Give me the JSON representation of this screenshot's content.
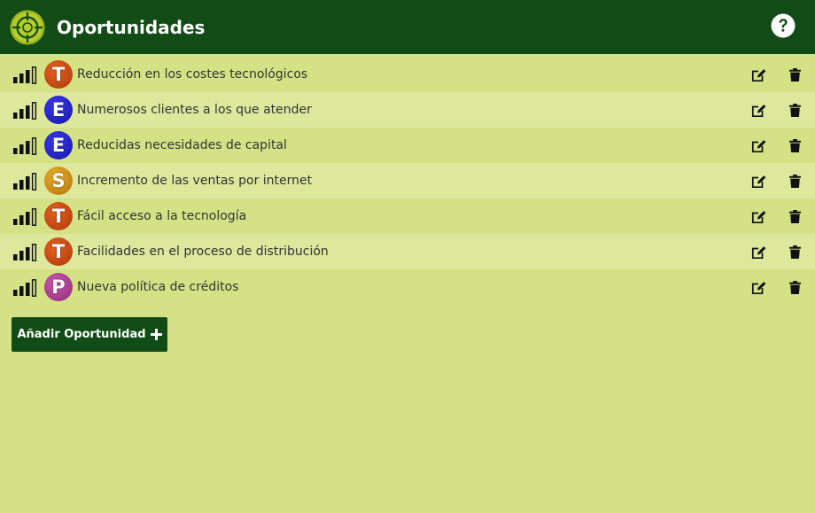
{
  "header": {
    "title": "Oportunidades",
    "logo_icon": "target-crosshair-icon",
    "help_icon": "question-circle-icon"
  },
  "items": [
    {
      "label": "Reducción en los costes tecnológicos",
      "letter": "T",
      "color": "#d9480f",
      "color_dark": "#a83a0c",
      "signal_level": 3
    },
    {
      "label": "Numerosos clientes a los que atender",
      "letter": "E",
      "color": "#2424d6",
      "color_dark": "#1616a0",
      "signal_level": 3
    },
    {
      "label": "Reducidas necesidades de capital",
      "letter": "E",
      "color": "#2424d6",
      "color_dark": "#1616a0",
      "signal_level": 3
    },
    {
      "label": "Incremento de las ventas por internet",
      "letter": "S",
      "color": "#dd9a10",
      "color_dark": "#b2700a",
      "signal_level": 3
    },
    {
      "label": "Fácil acceso a la tecnología",
      "letter": "T",
      "color": "#d9480f",
      "color_dark": "#a83a0c",
      "signal_level": 3
    },
    {
      "label": "Facilidades en el proceso de distribución",
      "letter": "T",
      "color": "#d9480f",
      "color_dark": "#a83a0c",
      "signal_level": 3
    },
    {
      "label": "Nueva política de créditos",
      "letter": "P",
      "color": "#b8409a",
      "color_dark": "#8c2c74",
      "signal_level": 3
    }
  ],
  "row_icons": {
    "signal": "signal-bars-icon",
    "edit": "edit-icon",
    "delete": "trash-icon"
  },
  "add_button": {
    "label": "Añadir Oportunidad",
    "icon": "plus-icon"
  },
  "colors": {
    "header_bg": "#114c16",
    "page_bg": "#d4e285",
    "row_alt_bg": "#dde89d",
    "button_bg": "#114c16"
  }
}
